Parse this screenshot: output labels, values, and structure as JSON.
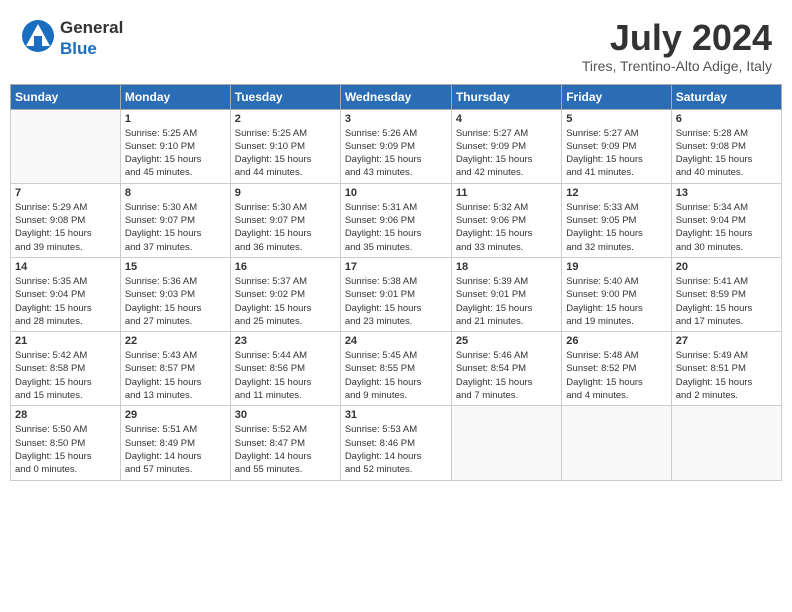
{
  "header": {
    "logo_general": "General",
    "logo_blue": "Blue",
    "month_title": "July 2024",
    "location": "Tires, Trentino-Alto Adige, Italy"
  },
  "days_of_week": [
    "Sunday",
    "Monday",
    "Tuesday",
    "Wednesday",
    "Thursday",
    "Friday",
    "Saturday"
  ],
  "weeks": [
    [
      {
        "day": "",
        "info": ""
      },
      {
        "day": "1",
        "info": "Sunrise: 5:25 AM\nSunset: 9:10 PM\nDaylight: 15 hours\nand 45 minutes."
      },
      {
        "day": "2",
        "info": "Sunrise: 5:25 AM\nSunset: 9:10 PM\nDaylight: 15 hours\nand 44 minutes."
      },
      {
        "day": "3",
        "info": "Sunrise: 5:26 AM\nSunset: 9:09 PM\nDaylight: 15 hours\nand 43 minutes."
      },
      {
        "day": "4",
        "info": "Sunrise: 5:27 AM\nSunset: 9:09 PM\nDaylight: 15 hours\nand 42 minutes."
      },
      {
        "day": "5",
        "info": "Sunrise: 5:27 AM\nSunset: 9:09 PM\nDaylight: 15 hours\nand 41 minutes."
      },
      {
        "day": "6",
        "info": "Sunrise: 5:28 AM\nSunset: 9:08 PM\nDaylight: 15 hours\nand 40 minutes."
      }
    ],
    [
      {
        "day": "7",
        "info": "Sunrise: 5:29 AM\nSunset: 9:08 PM\nDaylight: 15 hours\nand 39 minutes."
      },
      {
        "day": "8",
        "info": "Sunrise: 5:30 AM\nSunset: 9:07 PM\nDaylight: 15 hours\nand 37 minutes."
      },
      {
        "day": "9",
        "info": "Sunrise: 5:30 AM\nSunset: 9:07 PM\nDaylight: 15 hours\nand 36 minutes."
      },
      {
        "day": "10",
        "info": "Sunrise: 5:31 AM\nSunset: 9:06 PM\nDaylight: 15 hours\nand 35 minutes."
      },
      {
        "day": "11",
        "info": "Sunrise: 5:32 AM\nSunset: 9:06 PM\nDaylight: 15 hours\nand 33 minutes."
      },
      {
        "day": "12",
        "info": "Sunrise: 5:33 AM\nSunset: 9:05 PM\nDaylight: 15 hours\nand 32 minutes."
      },
      {
        "day": "13",
        "info": "Sunrise: 5:34 AM\nSunset: 9:04 PM\nDaylight: 15 hours\nand 30 minutes."
      }
    ],
    [
      {
        "day": "14",
        "info": "Sunrise: 5:35 AM\nSunset: 9:04 PM\nDaylight: 15 hours\nand 28 minutes."
      },
      {
        "day": "15",
        "info": "Sunrise: 5:36 AM\nSunset: 9:03 PM\nDaylight: 15 hours\nand 27 minutes."
      },
      {
        "day": "16",
        "info": "Sunrise: 5:37 AM\nSunset: 9:02 PM\nDaylight: 15 hours\nand 25 minutes."
      },
      {
        "day": "17",
        "info": "Sunrise: 5:38 AM\nSunset: 9:01 PM\nDaylight: 15 hours\nand 23 minutes."
      },
      {
        "day": "18",
        "info": "Sunrise: 5:39 AM\nSunset: 9:01 PM\nDaylight: 15 hours\nand 21 minutes."
      },
      {
        "day": "19",
        "info": "Sunrise: 5:40 AM\nSunset: 9:00 PM\nDaylight: 15 hours\nand 19 minutes."
      },
      {
        "day": "20",
        "info": "Sunrise: 5:41 AM\nSunset: 8:59 PM\nDaylight: 15 hours\nand 17 minutes."
      }
    ],
    [
      {
        "day": "21",
        "info": "Sunrise: 5:42 AM\nSunset: 8:58 PM\nDaylight: 15 hours\nand 15 minutes."
      },
      {
        "day": "22",
        "info": "Sunrise: 5:43 AM\nSunset: 8:57 PM\nDaylight: 15 hours\nand 13 minutes."
      },
      {
        "day": "23",
        "info": "Sunrise: 5:44 AM\nSunset: 8:56 PM\nDaylight: 15 hours\nand 11 minutes."
      },
      {
        "day": "24",
        "info": "Sunrise: 5:45 AM\nSunset: 8:55 PM\nDaylight: 15 hours\nand 9 minutes."
      },
      {
        "day": "25",
        "info": "Sunrise: 5:46 AM\nSunset: 8:54 PM\nDaylight: 15 hours\nand 7 minutes."
      },
      {
        "day": "26",
        "info": "Sunrise: 5:48 AM\nSunset: 8:52 PM\nDaylight: 15 hours\nand 4 minutes."
      },
      {
        "day": "27",
        "info": "Sunrise: 5:49 AM\nSunset: 8:51 PM\nDaylight: 15 hours\nand 2 minutes."
      }
    ],
    [
      {
        "day": "28",
        "info": "Sunrise: 5:50 AM\nSunset: 8:50 PM\nDaylight: 15 hours\nand 0 minutes."
      },
      {
        "day": "29",
        "info": "Sunrise: 5:51 AM\nSunset: 8:49 PM\nDaylight: 14 hours\nand 57 minutes."
      },
      {
        "day": "30",
        "info": "Sunrise: 5:52 AM\nSunset: 8:47 PM\nDaylight: 14 hours\nand 55 minutes."
      },
      {
        "day": "31",
        "info": "Sunrise: 5:53 AM\nSunset: 8:46 PM\nDaylight: 14 hours\nand 52 minutes."
      },
      {
        "day": "",
        "info": ""
      },
      {
        "day": "",
        "info": ""
      },
      {
        "day": "",
        "info": ""
      }
    ]
  ]
}
